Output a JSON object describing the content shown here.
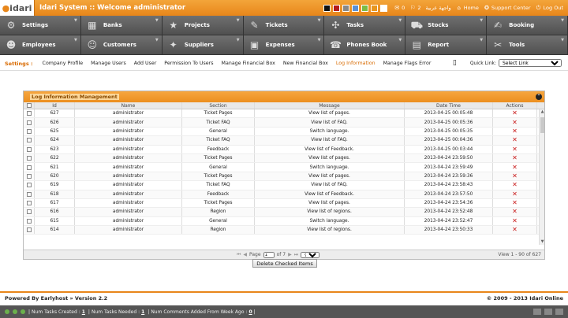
{
  "topbar": {
    "logo": "idari",
    "title": "Idari System :: Welcome administrator",
    "swatch_colors": [
      "#111111",
      "#b31b1b",
      "#888888",
      "#5a8fd6",
      "#7bbb43",
      "#e8961f",
      "#ffffff"
    ],
    "mail_count": "0",
    "tag_count": "2",
    "arabic_label": "واجهة عربية",
    "home_label": "Home",
    "support_label": "Support Center",
    "logout_label": "Log Out"
  },
  "menu": [
    {
      "label": "Settings",
      "icon": "wrench-icon",
      "glyph": "⚙"
    },
    {
      "label": "Banks",
      "icon": "bank-icon",
      "glyph": "▦"
    },
    {
      "label": "Projects",
      "icon": "star-icon",
      "glyph": "★"
    },
    {
      "label": "Tickets",
      "icon": "ticket-icon",
      "glyph": "✎"
    },
    {
      "label": "Tasks",
      "icon": "tasks-icon",
      "glyph": "✣"
    },
    {
      "label": "Stocks",
      "icon": "truck-icon",
      "glyph": "⛟"
    },
    {
      "label": "Booking",
      "icon": "booking-icon",
      "glyph": "✍"
    },
    {
      "label": "Employees",
      "icon": "employees-icon",
      "glyph": "☻"
    },
    {
      "label": "Customers",
      "icon": "customers-icon",
      "glyph": "☺"
    },
    {
      "label": "Suppliers",
      "icon": "suppliers-icon",
      "glyph": "✦"
    },
    {
      "label": "Expenses",
      "icon": "briefcase-icon",
      "glyph": "▣"
    },
    {
      "label": "Phones Book",
      "icon": "phone-icon",
      "glyph": "☎"
    },
    {
      "label": "Report",
      "icon": "report-icon",
      "glyph": "▤"
    },
    {
      "label": "Tools",
      "icon": "tools-icon",
      "glyph": "✂"
    }
  ],
  "subnav": {
    "label": "Settings :",
    "items": [
      "Company Profile",
      "Manage Users",
      "Add User",
      "Permission To Users",
      "Manage Financial Box",
      "New Financial Box",
      "Log Information",
      "Manage Flags Error"
    ],
    "active": "Log Information",
    "quick_label": "Quick Link:",
    "quick_value": "Select Link"
  },
  "grid": {
    "title": "Log Information Management",
    "columns": [
      "Id",
      "Name",
      "Section",
      "Message",
      "Date Time",
      "Actions"
    ],
    "rows": [
      [
        "627",
        "administrator",
        "Ticket Pages",
        "View list of pages.",
        "2013-04-25 00:05:48"
      ],
      [
        "626",
        "administrator",
        "Ticket FAQ",
        "View list of FAQ.",
        "2013-04-25 00:05:36"
      ],
      [
        "625",
        "administrator",
        "General",
        "Switch language.",
        "2013-04-25 00:05:35"
      ],
      [
        "624",
        "administrator",
        "Ticket FAQ",
        "View list of FAQ.",
        "2013-04-25 00:04:36"
      ],
      [
        "623",
        "administrator",
        "Feedback",
        "View list of Feedback.",
        "2013-04-25 00:03:44"
      ],
      [
        "622",
        "administrator",
        "Ticket Pages",
        "View list of pages.",
        "2013-04-24 23:59:50"
      ],
      [
        "621",
        "administrator",
        "General",
        "Switch language.",
        "2013-04-24 23:59:49"
      ],
      [
        "620",
        "administrator",
        "Ticket Pages",
        "View list of pages.",
        "2013-04-24 23:59:36"
      ],
      [
        "619",
        "administrator",
        "Ticket FAQ",
        "View list of FAQ.",
        "2013-04-24 23:58:43"
      ],
      [
        "618",
        "administrator",
        "Feedback",
        "View list of Feedback.",
        "2013-04-24 23:57:50"
      ],
      [
        "617",
        "administrator",
        "Ticket Pages",
        "View list of pages.",
        "2013-04-24 23:54:36"
      ],
      [
        "616",
        "administrator",
        "Region",
        "View list of regions.",
        "2013-04-24 23:52:48"
      ],
      [
        "615",
        "administrator",
        "General",
        "Switch language.",
        "2013-04-24 23:52:47"
      ],
      [
        "614",
        "administrator",
        "Region",
        "View list of regions.",
        "2013-04-24 23:50:33"
      ]
    ],
    "pager": {
      "page_label": "Page",
      "page_value": "1",
      "of_label": "of 7",
      "per_page": "90",
      "summary": "View 1 - 90 of 627"
    },
    "delete_checked": "Delete Checked Items"
  },
  "footer": {
    "powered": "Powered By Earlyhost » Version 2.2",
    "copyright": "© 2009 - 2013 Idari Online",
    "tasks_created_label": "Num Tasks Created :",
    "tasks_created": "1",
    "tasks_needed_label": "Num Tasks Needed :",
    "tasks_needed": "1",
    "comments_label": "Num Comments Added From Week Ago :",
    "comments": "0"
  }
}
